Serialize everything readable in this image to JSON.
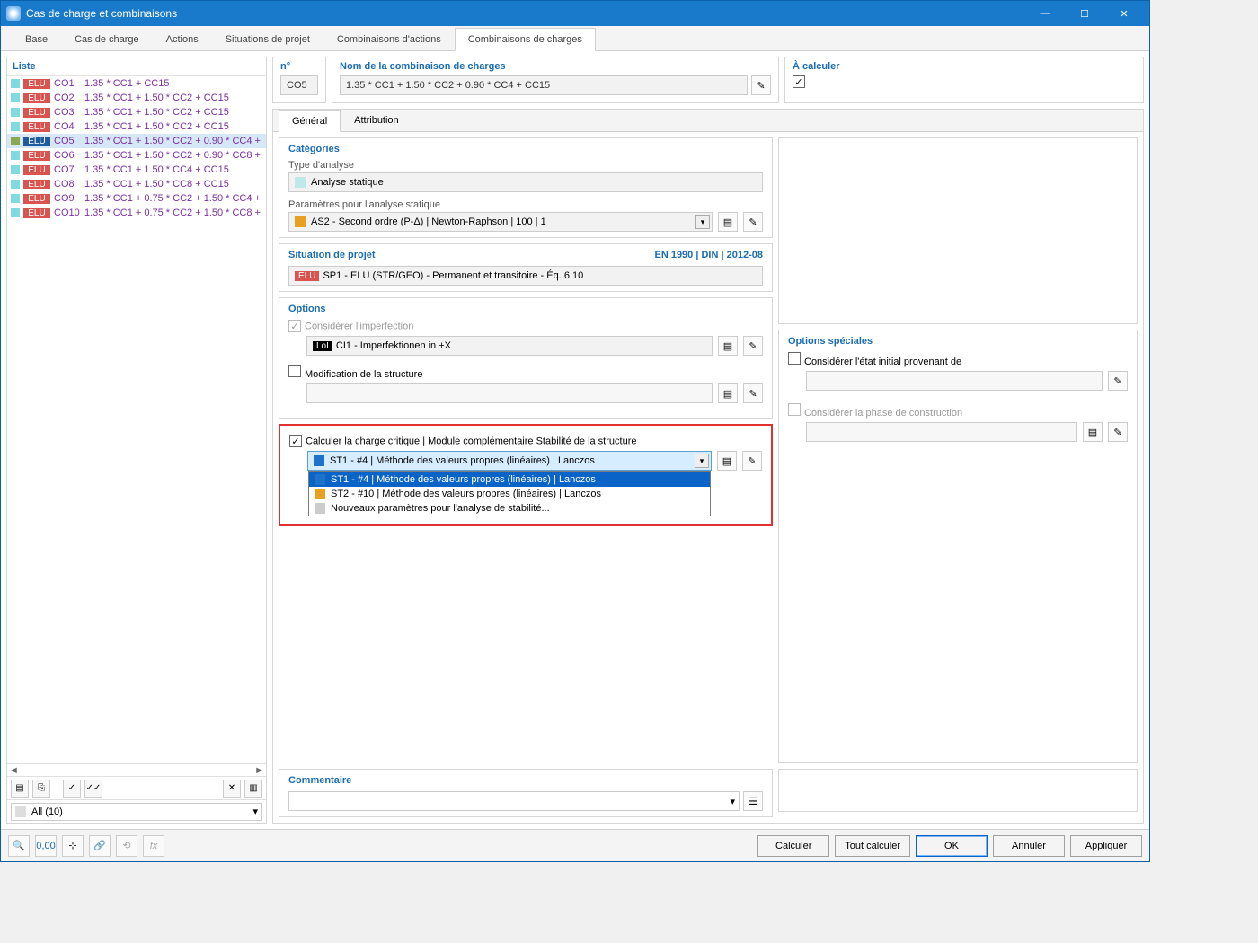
{
  "window": {
    "title": "Cas de charge et combinaisons"
  },
  "tabs": [
    "Base",
    "Cas de charge",
    "Actions",
    "Situations de projet",
    "Combinaisons d'actions",
    "Combinaisons de charges"
  ],
  "active_tab": 5,
  "list_header": "Liste",
  "list": [
    {
      "sw": "#7edce0",
      "elu": "ELU",
      "co": "CO1",
      "f": "1.35 * CC1 + CC15"
    },
    {
      "sw": "#7edce0",
      "elu": "ELU",
      "co": "CO2",
      "f": "1.35 * CC1 + 1.50 * CC2 + CC15"
    },
    {
      "sw": "#7edce0",
      "elu": "ELU",
      "co": "CO3",
      "f": "1.35 * CC1 + 1.50 * CC2 + CC15"
    },
    {
      "sw": "#7edce0",
      "elu": "ELU",
      "co": "CO4",
      "f": "1.35 * CC1 + 1.50 * CC2 + CC15"
    },
    {
      "sw": "#8aa84f",
      "elu": "ELU",
      "co": "CO5",
      "f": "1.35 * CC1 + 1.50 * CC2 + 0.90 * CC4 +",
      "sel": true
    },
    {
      "sw": "#7edce0",
      "elu": "ELU",
      "co": "CO6",
      "f": "1.35 * CC1 + 1.50 * CC2 + 0.90 * CC8 +"
    },
    {
      "sw": "#7edce0",
      "elu": "ELU",
      "co": "CO7",
      "f": "1.35 * CC1 + 1.50 * CC4 + CC15"
    },
    {
      "sw": "#7edce0",
      "elu": "ELU",
      "co": "CO8",
      "f": "1.35 * CC1 + 1.50 * CC8 + CC15"
    },
    {
      "sw": "#7edce0",
      "elu": "ELU",
      "co": "CO9",
      "f": "1.35 * CC1 + 0.75 * CC2 + 1.50 * CC4 +"
    },
    {
      "sw": "#7edce0",
      "elu": "ELU",
      "co": "CO10",
      "f": "1.35 * CC1 + 0.75 * CC2 + 1.50 * CC8 +"
    }
  ],
  "filter_label": "All (10)",
  "header": {
    "num_label": "n°",
    "num_val": "CO5",
    "name_label": "Nom de la combinaison de charges",
    "name_val": "1.35 * CC1 + 1.50 * CC2 + 0.90 * CC4 + CC15",
    "calc_label": "À calculer"
  },
  "subtabs": [
    "Général",
    "Attribution"
  ],
  "subtab_active": 0,
  "categories": {
    "title": "Catégories",
    "type_label": "Type d'analyse",
    "type_val": "Analyse statique",
    "params_label": "Paramètres pour l'analyse statique",
    "params_val": "AS2 - Second ordre (P-Δ) | Newton-Raphson | 100 | 1"
  },
  "situation": {
    "title": "Situation de projet",
    "std": "EN 1990 | DIN | 2012-08",
    "val": "SP1 - ELU (STR/GEO) - Permanent et transitoire - Éq. 6.10"
  },
  "options": {
    "title": "Options",
    "imperf_label": "Considérer l'imperfection",
    "imperf_val": "CI1 - Imperfektionen in +X",
    "mod_label": "Modification de la structure",
    "crit_label": "Calculer la charge critique | Module complémentaire Stabilité de la structure",
    "crit_val": "ST1 - #4 | Méthode des valeurs propres (linéaires) | Lanczos",
    "crit_items": [
      {
        "sw": "#1f72c9",
        "t": "ST1 - #4 | Méthode des valeurs propres (linéaires) | Lanczos",
        "sel": true
      },
      {
        "sw": "#e8a020",
        "t": "ST2 - #10 | Méthode des valeurs propres (linéaires) | Lanczos"
      },
      {
        "sw": "#cccccc",
        "t": "Nouveaux paramètres pour l'analyse de stabilité..."
      }
    ]
  },
  "special": {
    "title": "Options spéciales",
    "init_label": "Considérer l'état initial provenant de",
    "phase_label": "Considérer la phase de construction"
  },
  "comment_title": "Commentaire",
  "footer_buttons": [
    "Calculer",
    "Tout calculer",
    "OK",
    "Annuler",
    "Appliquer"
  ]
}
